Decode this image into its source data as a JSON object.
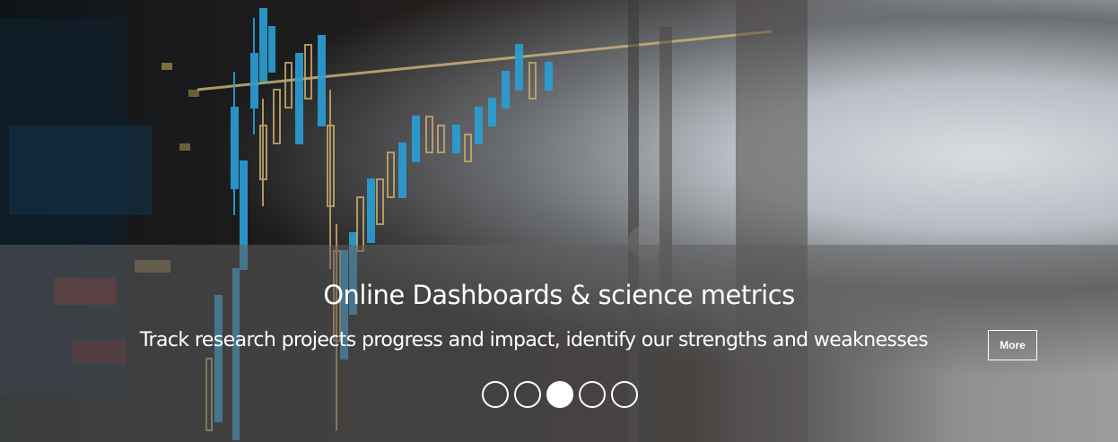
{
  "slide": {
    "title": "Online Dashboards & science metrics",
    "subtitle": "Track research projects progress and impact, identify our strengths and weaknesses",
    "more_label": "More"
  },
  "carousel": {
    "count": 5,
    "active_index": 2
  },
  "colors": {
    "overlay": "#5f5f5f",
    "text": "#ffffff",
    "candle_blue": "#2a9fd6",
    "candle_gold": "#c9a96a"
  }
}
